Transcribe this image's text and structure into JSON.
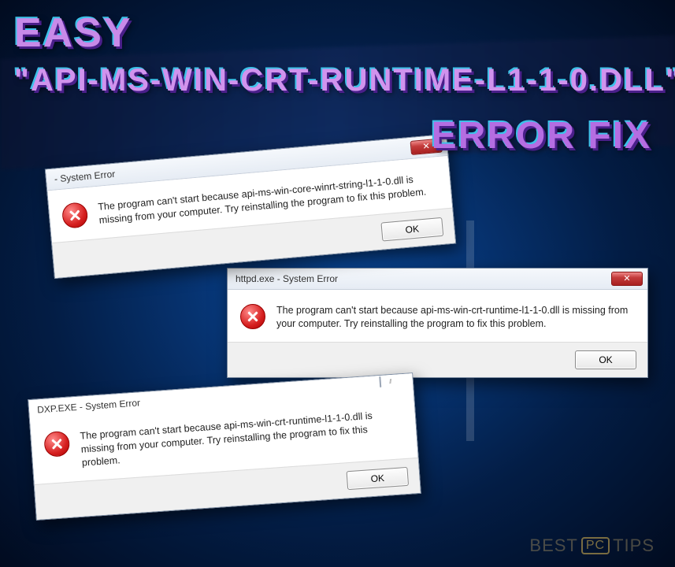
{
  "headline": {
    "easy": "EASY",
    "main": "\"API-MS-WIN-CRT-RUNTIME-L1-1-0.DLL\"",
    "errorfix": "ERROR FIX"
  },
  "dialog1": {
    "title": " - System Error",
    "close": "✕",
    "message": "The program can't start because api-ms-win-core-winrt-string-l1-1-0.dll is missing from your computer. Try reinstalling the program to fix this problem.",
    "ok": "OK"
  },
  "dialog2": {
    "title": "httpd.exe - System Error",
    "close": "✕",
    "message": "The program can't start because api-ms-win-crt-runtime-l1-1-0.dll is missing from your computer. Try reinstalling the program to fix this problem.",
    "ok": "OK"
  },
  "dialog3": {
    "title": "DXP.EXE - System Error",
    "message": "The program can't start because api-ms-win-crt-runtime-l1-1-0.dll is missing from your computer. Try reinstalling the program to fix this problem.",
    "ok": "OK"
  },
  "brand": {
    "left": "BEST",
    "pc": "PC",
    "right": "TIPS"
  }
}
